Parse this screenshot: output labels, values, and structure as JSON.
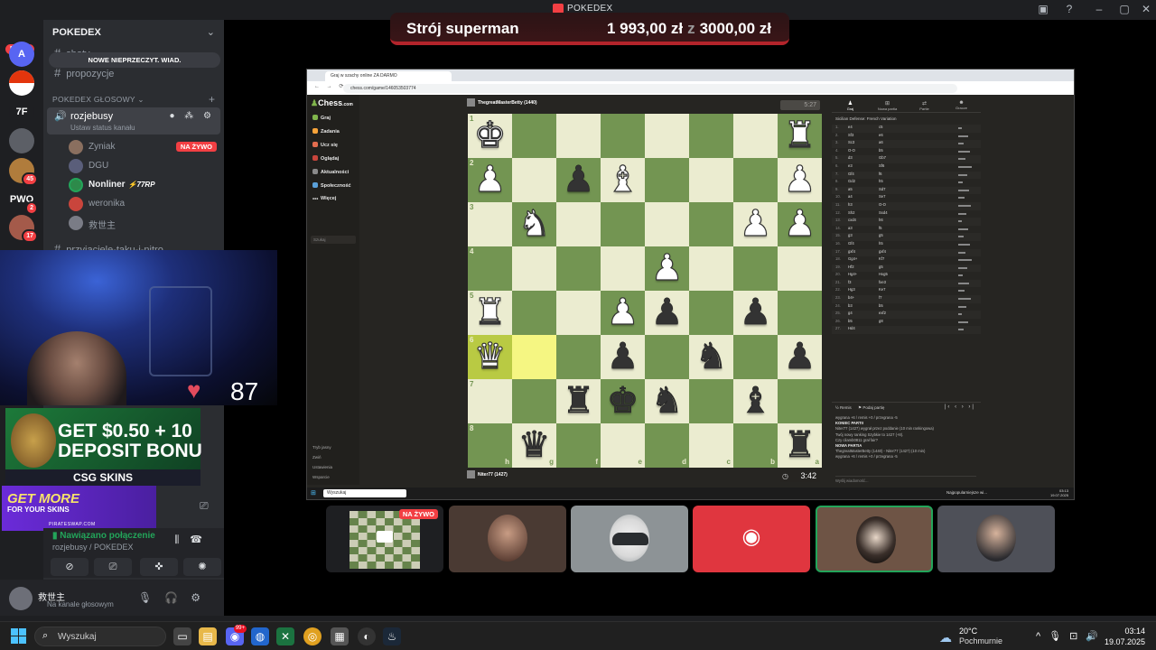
{
  "window": {
    "title": "POKEDEX",
    "controls": [
      "inbox-icon",
      "help-icon",
      "minimize-icon",
      "maximize-icon",
      "close-icon"
    ]
  },
  "donation": {
    "name": "Strój superman",
    "amount": "1 993,00 zł",
    "separator": "z",
    "goal": "3000,00 zł"
  },
  "server_rail": {
    "new_label": "NOWE",
    "servers": [
      {
        "label": "A",
        "badge": ""
      },
      {
        "label": "",
        "badge": ""
      },
      {
        "label": "7F",
        "badge": ""
      },
      {
        "label": "",
        "badge": ""
      },
      {
        "label": "",
        "badge": "45"
      },
      {
        "label": "PWO",
        "badge": "2"
      },
      {
        "label": "",
        "badge": "17"
      }
    ]
  },
  "sidebar": {
    "server_name": "POKEDEX",
    "text_channels": [
      "shoty",
      "propozycje"
    ],
    "unread_toast": "NOWE NIEPRZECZYT. WIAD.",
    "voice_category": "POKEDEX GŁOSOWY",
    "voice_channel": {
      "name": "rozjebusy",
      "status": "Ustaw status kanału"
    },
    "voice_users": [
      {
        "name": "Zyniak",
        "live": "NA ŻYWO"
      },
      {
        "name": "DGU"
      },
      {
        "name": "Nonliner",
        "tag": "77RP"
      },
      {
        "name": "weronika"
      },
      {
        "name": "救世主"
      }
    ],
    "next_channel": "przyjaciele-taku-i-nitro"
  },
  "heart_rate": {
    "value": "87"
  },
  "ads": {
    "ad1_line1": "GET $0.50 + 10",
    "ad1_line2": "DEPOSIT BONU",
    "ad1_brand": "CSG SKINS",
    "ad2_line1": "GET MORE",
    "ad2_line2": "FOR YOUR SKINS",
    "ad2_brand": "PIRATESWAP.COM"
  },
  "voice_panel": {
    "status": "Nawiązano połączenie",
    "where": "rozjebusy / POKEDEX"
  },
  "user_panel": {
    "name": "救世主",
    "status": "Na kanale głosowym"
  },
  "browser": {
    "tab_title": "Graj w szachy online ZA DARMO",
    "url": "chess.com/game/146053503774",
    "nav": {
      "logo": "Chess",
      "logo_suffix": ".com",
      "items": [
        "Graj",
        "Zadania",
        "Ucz się",
        "Oglądaj",
        "Aktualności",
        "Społeczność",
        "Więcej"
      ],
      "search": "Szukaj",
      "footer": [
        "Tryb jasny",
        "Zwiń",
        "Ustawienia",
        "Wsparcie"
      ]
    },
    "player_top": {
      "name": "ThegreatMasterBetty",
      "rating": "(1440)"
    },
    "player_bottom": {
      "name": "Niter77",
      "rating": "(1427)"
    },
    "clock_top": "5:27",
    "clock_bottom": "3:42",
    "tabs": [
      "Graj",
      "Nowa partia",
      "Partie",
      "Gracze"
    ],
    "opening": "Sicilian Defense: French Variation",
    "moves": [
      [
        "1.",
        "e4",
        "c5"
      ],
      [
        "2.",
        "Sf3",
        "e6"
      ],
      [
        "3.",
        "Sc3",
        "a6"
      ],
      [
        "4.",
        "O-O",
        "b5"
      ],
      [
        "5.",
        "d3",
        "Gb7"
      ],
      [
        "6.",
        "e3",
        "Sf6"
      ],
      [
        "7.",
        "Gf4",
        "f6"
      ],
      [
        "8.",
        "Gd2",
        "h5"
      ],
      [
        "9.",
        "a5",
        "Sd7"
      ],
      [
        "10.",
        "a4",
        "Se7"
      ],
      [
        "11.",
        "h3",
        "O-O"
      ],
      [
        "12.",
        "Sh2",
        "Sxd4"
      ],
      [
        "13.",
        "cxd4",
        "h6"
      ],
      [
        "14.",
        "a3",
        "f5"
      ],
      [
        "15.",
        "g3",
        "g5"
      ],
      [
        "16.",
        "Gf4",
        "h5"
      ],
      [
        "17.",
        "gxf4",
        "gxf4"
      ],
      [
        "18.",
        "Gg4+",
        "Kf7"
      ],
      [
        "19.",
        "Hf2",
        "g5"
      ],
      [
        "20.",
        "Hg4+",
        "Hxg5"
      ],
      [
        "21.",
        "f3",
        "fxe3"
      ],
      [
        "22.",
        "Hg3",
        "Ke7"
      ],
      [
        "23.",
        "b4+",
        "f7"
      ],
      [
        "24.",
        "b3",
        "b5"
      ],
      [
        "25.",
        "g4",
        "exf2"
      ],
      [
        "26.",
        "b5",
        "g8"
      ],
      [
        "27.",
        "Hd4",
        ""
      ]
    ],
    "controls_label": "Remis",
    "controls_label2": "Podaj partię",
    "chat": [
      "wygrana +6 / remis +0 / przegrana -5",
      "KONIEC PARTII",
      "Niter77 (1427) wygrał przez poddanie (10 min rankingowa)",
      "Twój nowy ranking Szybkie to 1427 (+8).",
      "Czy cilamb0811 grał fair?",
      "NOWA PARTIA",
      "ThegreatMasterBetty (1440) - Niter77 (1427) (10 min)",
      "wygrana +6 / remis +0 / przegrana -5"
    ],
    "chat_input": "Wyślij wiadomość...",
    "os_search": "Wyszukaj",
    "news": "Najpopularniejsze wi...",
    "time": "03:13",
    "date": "19.07.2025"
  },
  "board": {
    "rank_labels": [
      "1",
      "2",
      "3",
      "4",
      "5",
      "6",
      "7",
      "8"
    ],
    "file_labels": [
      "h",
      "g",
      "f",
      "e",
      "d",
      "c",
      "b",
      "a"
    ],
    "rows": [
      [
        "wK",
        "",
        "",
        "",
        "",
        "",
        "",
        "wR"
      ],
      [
        "wP",
        "",
        "bP",
        "wB",
        "",
        "",
        "",
        "wP"
      ],
      [
        "",
        "wN",
        "",
        "",
        "",
        "",
        "wP",
        "wP"
      ],
      [
        "",
        "",
        "",
        "",
        "wP",
        "",
        "",
        ""
      ],
      [
        "wR",
        "",
        "",
        "wP",
        "bP",
        "",
        "bP",
        ""
      ],
      [
        "wQ",
        "",
        "",
        "bP",
        "",
        "bN",
        "",
        "bP"
      ],
      [
        "",
        "",
        "bR",
        "bK",
        "bN",
        "",
        "bB",
        ""
      ],
      [
        "",
        "bQ",
        "",
        "",
        "",
        "",
        "",
        "bR"
      ]
    ],
    "highlight": [
      [
        5,
        0
      ],
      [
        5,
        1
      ]
    ]
  },
  "tiles": [
    {
      "name": "stream-tile",
      "live": "NA ŻYWO"
    },
    {
      "name": "participant-2"
    },
    {
      "name": "participant-3"
    },
    {
      "name": "participant-4"
    },
    {
      "name": "participant-5"
    },
    {
      "name": "participant-6"
    }
  ],
  "taskbar": {
    "search": "Wyszukaj",
    "discord_badge": "99+",
    "weather_temp": "20°C",
    "weather_desc": "Pochmurnie",
    "time": "03:14",
    "date": "19.07.2025"
  },
  "colors": {
    "discord_bg": "#1e1f22",
    "sidebar": "#2b2d31",
    "live_red": "#f23f43",
    "board_light": "#ebecd0",
    "board_dark": "#739552",
    "highlight": "#f5f682"
  }
}
